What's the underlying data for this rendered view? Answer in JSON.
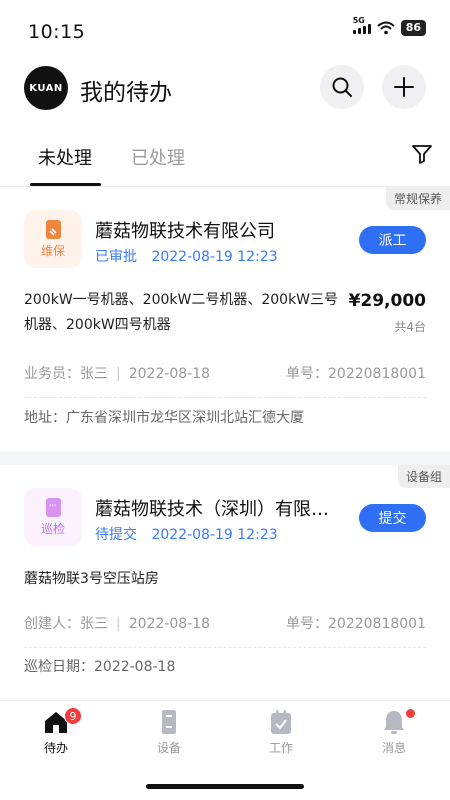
{
  "status_bar": {
    "time": "10:15",
    "network": "5G",
    "battery": "86"
  },
  "header": {
    "logo_text": "KUAN",
    "title": "我的待办"
  },
  "tabs": [
    {
      "label": "未处理"
    },
    {
      "label": "已处理"
    }
  ],
  "cards": [
    {
      "corner_tag": "常规保养",
      "icon_label": "维保",
      "title": "蘑菇物联技术有限公司",
      "status": "已审批",
      "time": "2022-08-19 12:23",
      "action": "派工",
      "description": "200kW一号机器、200kW二号机器、200kW三号机器、200kW四号机器",
      "amount": "¥29,000",
      "quantity": "共4台",
      "person": "业务员：张三",
      "date": "2022-08-18",
      "order": "单号：20220818001",
      "extra": "地址：广东省深圳市龙华区深圳北站汇德大厦"
    },
    {
      "corner_tag": "设备组",
      "icon_label": "巡检",
      "title": "蘑菇物联技术（深圳）有限公司",
      "status": "待提交",
      "time": "2022-08-19 12:23",
      "action": "提交",
      "description": "蘑菇物联3号空压站房",
      "person": "创建人：张三",
      "date": "2022-08-18",
      "order": "单号：20220818001",
      "extra": "巡检日期：2022-08-18"
    }
  ],
  "bottom_nav": [
    {
      "label": "待办",
      "icon": "home-icon",
      "badge": "9",
      "active": true
    },
    {
      "label": "设备",
      "icon": "device-icon"
    },
    {
      "label": "工作",
      "icon": "clipboard-check-icon"
    },
    {
      "label": "消息",
      "icon": "bell-icon",
      "dot": true
    }
  ],
  "colors": {
    "accent": "#2f6ff6",
    "status_text": "#3a7cf6",
    "maint_icon": "#f0853e",
    "insp_icon": "#c070e8",
    "badge": "#f23d3d"
  }
}
